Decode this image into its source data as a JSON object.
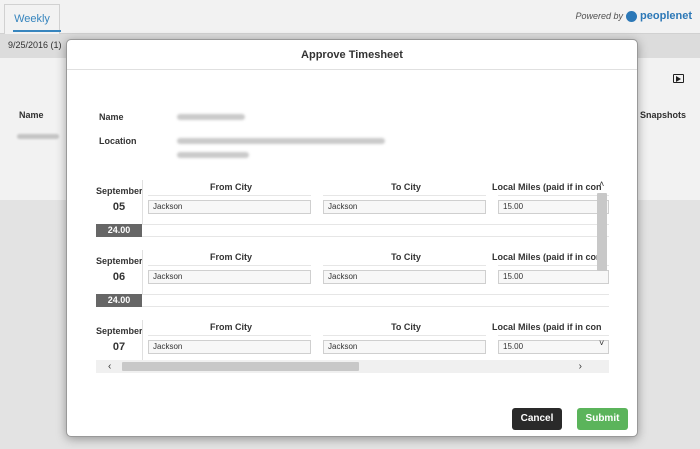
{
  "background": {
    "tab_label": "Weekly",
    "powered_by": "Powered by",
    "brand_name": "peoplenet",
    "date_range": "9/25/2016 (1)",
    "name_header": "Name",
    "snapshots_header": "Snapshots"
  },
  "modal": {
    "title": "Approve Timesheet",
    "name_label": "Name",
    "location_label": "Location",
    "columns": {
      "from_city": "From City",
      "to_city": "To City",
      "local_miles": "Local Miles (paid if in con"
    },
    "days": [
      {
        "month": "September",
        "day": "05",
        "total": "24.00",
        "from_city": "Jackson",
        "to_city": "Jackson",
        "local_miles": "15.00"
      },
      {
        "month": "September",
        "day": "06",
        "total": "24.00",
        "from_city": "Jackson",
        "to_city": "Jackson",
        "local_miles": "15.00"
      },
      {
        "month": "September",
        "day": "07",
        "total": "",
        "from_city": "Jackson",
        "to_city": "Jackson",
        "local_miles": "15.00"
      }
    ],
    "cancel_label": "Cancel",
    "submit_label": "Submit"
  },
  "colors": {
    "accent": "#3a8dc9",
    "submit": "#5bb45b",
    "cancel": "#2a2a2a",
    "total_badge": "#666666"
  },
  "icons": {
    "play": "play-screen-icon",
    "brand": "peoplenet-logo-icon"
  }
}
